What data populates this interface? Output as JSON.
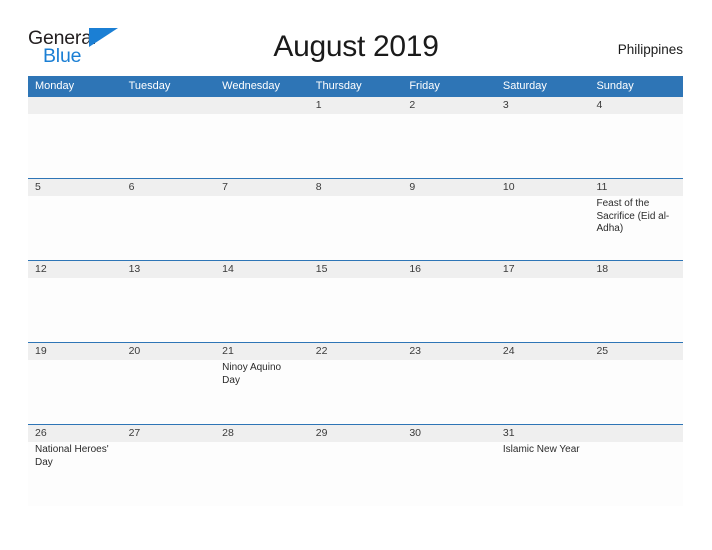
{
  "brand": {
    "name_part1": "General",
    "name_part2": "Blue",
    "flag_color": "#1b7fd4"
  },
  "header": {
    "title": "August 2019",
    "country": "Philippines"
  },
  "theme": {
    "header_blue": "#2e75b6",
    "date_strip_gray": "#efefef",
    "accent_blue": "#1b7fd4"
  },
  "calendar": {
    "weekdays": [
      "Monday",
      "Tuesday",
      "Wednesday",
      "Thursday",
      "Friday",
      "Saturday",
      "Sunday"
    ],
    "weeks": [
      {
        "dates": [
          "",
          "",
          "",
          "1",
          "2",
          "3",
          "4"
        ],
        "events": [
          "",
          "",
          "",
          "",
          "",
          "",
          ""
        ]
      },
      {
        "dates": [
          "5",
          "6",
          "7",
          "8",
          "9",
          "10",
          "11"
        ],
        "events": [
          "",
          "",
          "",
          "",
          "",
          "",
          "Feast of the Sacrifice (Eid al-Adha)"
        ]
      },
      {
        "dates": [
          "12",
          "13",
          "14",
          "15",
          "16",
          "17",
          "18"
        ],
        "events": [
          "",
          "",
          "",
          "",
          "",
          "",
          ""
        ]
      },
      {
        "dates": [
          "19",
          "20",
          "21",
          "22",
          "23",
          "24",
          "25"
        ],
        "events": [
          "",
          "",
          "Ninoy Aquino Day",
          "",
          "",
          "",
          ""
        ]
      },
      {
        "dates": [
          "26",
          "27",
          "28",
          "29",
          "30",
          "31",
          ""
        ],
        "events": [
          "National Heroes' Day",
          "",
          "",
          "",
          "",
          "Islamic New Year",
          ""
        ]
      }
    ]
  }
}
